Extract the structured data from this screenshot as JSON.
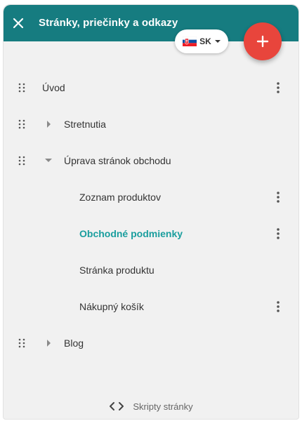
{
  "header": {
    "title": "Stránky, priečinky a odkazy",
    "close_icon": "close-icon",
    "background": "#167c80"
  },
  "language": {
    "code": "SK",
    "flag_icon": "slovakia-flag-icon"
  },
  "add_button": {
    "icon": "plus-icon",
    "color": "#e8453c"
  },
  "tree": {
    "items": [
      {
        "label": "Úvod",
        "level": 0,
        "expander": "none",
        "has_menu": true,
        "active": false
      },
      {
        "label": "Stretnutia",
        "level": 0,
        "expander": "collapsed",
        "has_menu": false,
        "active": false
      },
      {
        "label": "Úprava stránok obchodu",
        "level": 0,
        "expander": "expanded",
        "has_menu": false,
        "active": false
      },
      {
        "label": "Zoznam produktov",
        "level": 1,
        "expander": "none",
        "has_menu": true,
        "active": false
      },
      {
        "label": "Obchodné podmienky",
        "level": 1,
        "expander": "none",
        "has_menu": true,
        "active": true
      },
      {
        "label": "Stránka produktu",
        "level": 1,
        "expander": "none",
        "has_menu": false,
        "active": false
      },
      {
        "label": "Nákupný košík",
        "level": 1,
        "expander": "none",
        "has_menu": true,
        "active": false
      },
      {
        "label": "Blog",
        "level": 0,
        "expander": "collapsed",
        "has_menu": false,
        "active": false
      }
    ],
    "active_color": "#1a9e9e"
  },
  "footer": {
    "label": "Skripty stránky",
    "icon": "code-icon"
  }
}
